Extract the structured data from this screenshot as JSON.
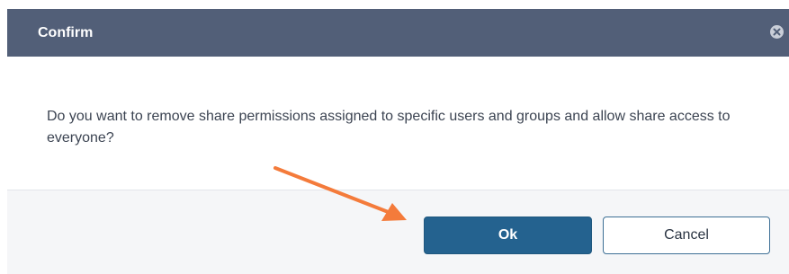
{
  "dialog": {
    "title": "Confirm",
    "message": "Do you want to remove share permissions assigned to specific users and groups and allow share access to everyone?",
    "ok_label": "Ok",
    "cancel_label": "Cancel"
  },
  "icons": {
    "close": "close-icon",
    "annotation": "orange-arrow-annotation"
  },
  "colors": {
    "header_bg": "#525f78",
    "ok_bg": "#24628f",
    "annotation_arrow": "#f47b3b"
  }
}
